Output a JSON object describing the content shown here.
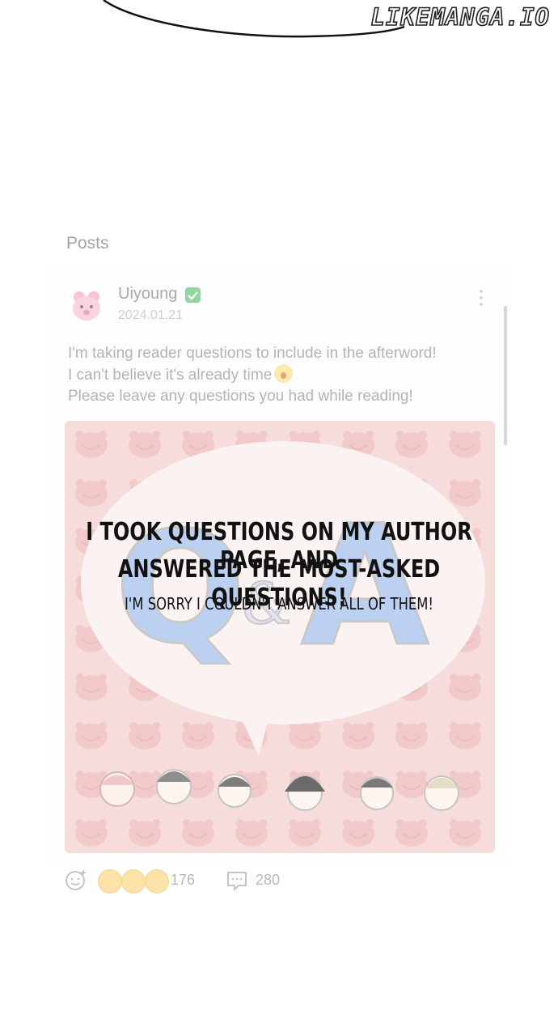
{
  "watermark": "LIKEMANGA.IO",
  "panel": {
    "posts_title": "Posts",
    "post": {
      "author": "Uiyoung",
      "verified": true,
      "date": "2024.01.21",
      "body_lines": [
        "I'm taking reader questions to include in the afterword!",
        "I can't believe it's already time",
        "Please leave any questions you had while reading!"
      ],
      "image_label": "Q&A",
      "reaction_count": "176",
      "comment_count": "280"
    }
  },
  "caption": {
    "line1": "I took questions on my author page, and",
    "line2": "answered the most-asked questions!",
    "line3": "I'm sorry I couldn't answer all of them!"
  },
  "icons": {
    "more": "more-vertical-icon",
    "add_reaction": "smiley-plus-icon",
    "comment": "comment-bubble-icon"
  },
  "colors": {
    "faded_text": "#a9a9a9",
    "verified": "#8fd6a0",
    "image_bg": "#f6dada",
    "qa_letters": "#b7cdf0",
    "caption_text": "#111111"
  }
}
